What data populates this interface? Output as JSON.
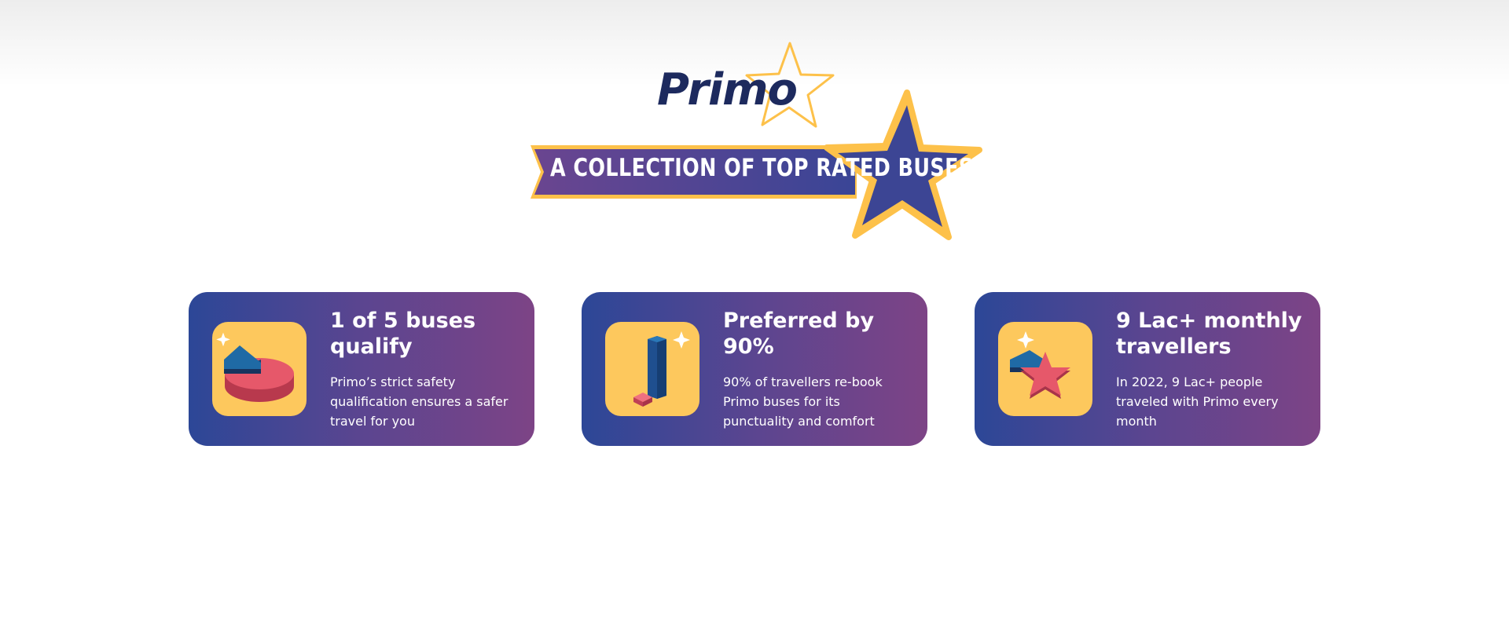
{
  "brand": {
    "name": "Primo",
    "tagline": "A COLLECTION OF TOP RATED BUSES"
  },
  "colors": {
    "navy": "#1d2a5e",
    "star_yellow": "#fdc14a",
    "icon_bg": "#fdc85d",
    "card_gradient_start": "#2c4797",
    "card_gradient_end": "#7d4486"
  },
  "cards": [
    {
      "title": "1 of 5 buses qualify",
      "description": "Primo’s strict safety qualification ensures a safer travel for you",
      "icon": "pie-chart-icon"
    },
    {
      "title": "Preferred by 90%",
      "description": "90% of travellers re-book Primo buses for its punctuality and comfort",
      "icon": "bar-chart-icon"
    },
    {
      "title": "9 Lac+ monthly travellers",
      "description": "In 2022, 9 Lac+ people traveled with Primo every month",
      "icon": "star-pie-icon"
    }
  ]
}
